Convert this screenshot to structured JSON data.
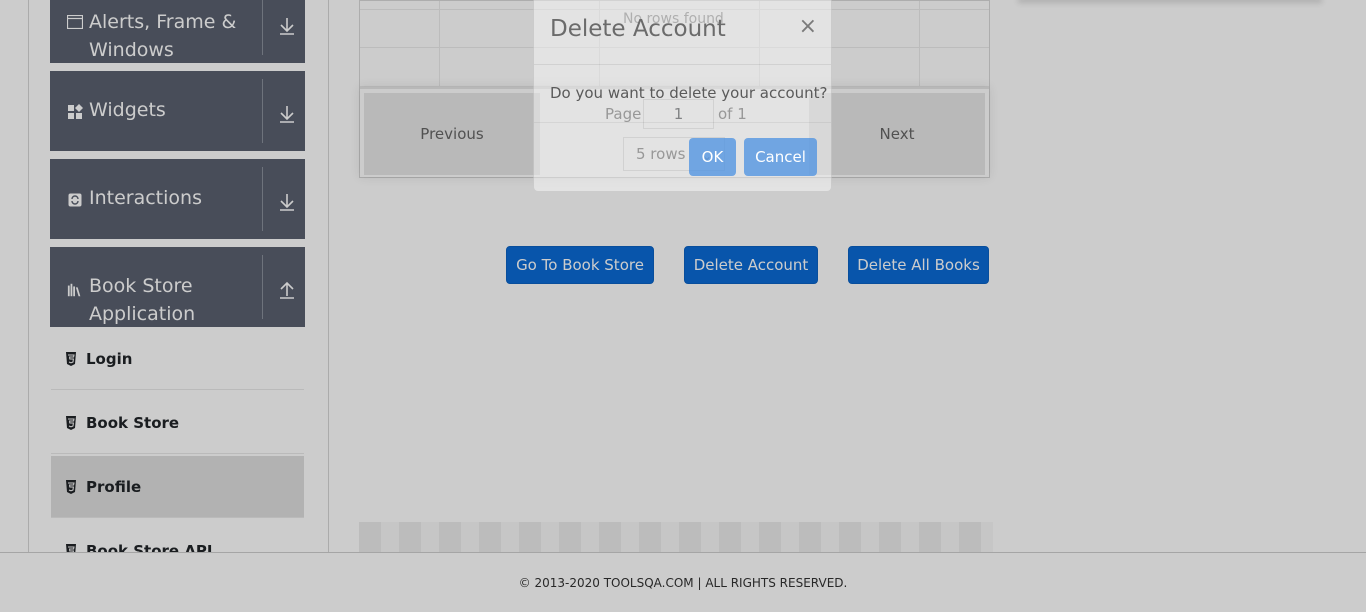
{
  "sidebar": {
    "groups": [
      {
        "label_line1": "Alerts, Frame &",
        "label_line2": "Windows",
        "icon": "window-icon",
        "arrow": "down"
      },
      {
        "label": "Widgets",
        "icon": "widgets-icon",
        "arrow": "down"
      },
      {
        "label": "Interactions",
        "icon": "interactions-icon",
        "arrow": "down"
      },
      {
        "label_line1": "Book Store",
        "label_line2": "Application",
        "icon": "books-icon",
        "arrow": "up"
      }
    ],
    "items": [
      {
        "label": "Login",
        "active": false
      },
      {
        "label": "Book Store",
        "active": false
      },
      {
        "label": "Profile",
        "active": true
      },
      {
        "label": "Book Store API",
        "active": false
      }
    ]
  },
  "table": {
    "no_rows": "No rows found",
    "pagination": {
      "previous": "Previous",
      "next": "Next",
      "page_label": "Page",
      "page_value": "1",
      "of_label": "of 1",
      "rows_select": "5 rows"
    }
  },
  "actions": {
    "go_to_book_store": "Go To Book Store",
    "delete_account": "Delete Account",
    "delete_all_books": "Delete All Books"
  },
  "modal": {
    "title": "Delete Account",
    "close": "×",
    "body": "Do you want to delete your account?",
    "ok": "OK",
    "cancel": "Cancel"
  },
  "footer": {
    "text": "© 2013-2020 TOOLSQA.COM | ALL RIGHTS RESERVED."
  },
  "colors": {
    "sidebar_group_bg": "#5a6170",
    "primary_button": "#0b6bd6",
    "modal_button": "#4a90e2"
  }
}
